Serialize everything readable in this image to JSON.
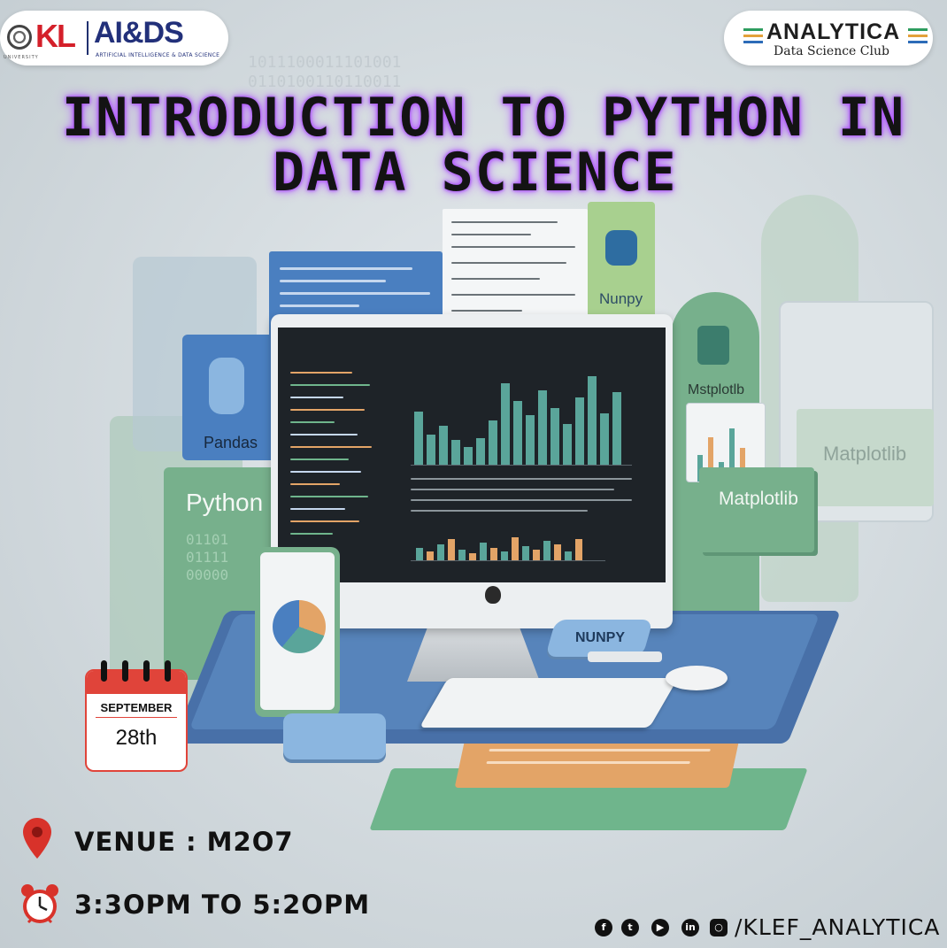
{
  "logos": {
    "left": {
      "kl": "KL",
      "university": "UNIVERSITY",
      "department": "AI&DS",
      "department_full": "ARTIFICIAL INTELLIGENCE & DATA SCIENCE"
    },
    "right": {
      "club_name": "ANALYTICA",
      "club_subtitle": "Data Science Club"
    }
  },
  "title": {
    "line1": "INTRODUCTION TO PYTHON IN",
    "line2": "DATA SCIENCE"
  },
  "illustration": {
    "labels": {
      "python": "Python",
      "pandas": "Pandas",
      "numpy": "Nunpy",
      "numpy_box": "NUNPY",
      "matplotlib": "Matplotlib",
      "matplotlib_2": "Mstplotlb",
      "matplotlib_3": "Matplotlib"
    },
    "colors": {
      "green": "#6fb58c",
      "blue": "#4a7fc0",
      "orange": "#e3a467",
      "teal_bar": "#5aa59a",
      "screen": "#1e2328"
    }
  },
  "event": {
    "date": {
      "month": "SEPTEMBER",
      "day": "28th"
    },
    "venue": "VENUE : M2O7",
    "time": "3:3OPM TO 5:2OPM"
  },
  "social": {
    "icons": [
      "facebook-icon",
      "twitter-icon",
      "youtube-icon",
      "linkedin-icon",
      "instagram-icon"
    ],
    "handle": "/KLEF_ANALYTICA"
  }
}
